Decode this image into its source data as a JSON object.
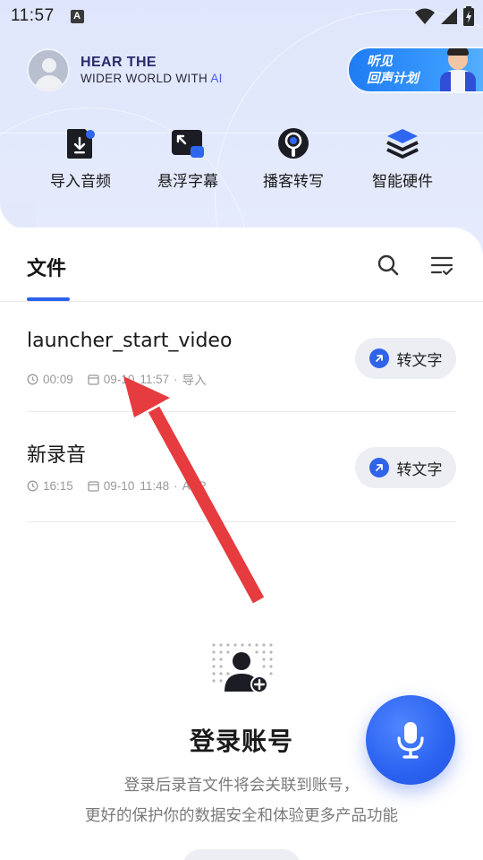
{
  "status_bar": {
    "time": "11:57",
    "notification_icon": "A"
  },
  "header": {
    "slogan_line1_prefix": "HEAR THE",
    "slogan_line2": "WIDER WORLD WITH",
    "slogan_line2_ai": "AI",
    "promo_line1": "听见",
    "promo_line2": "回声计划"
  },
  "quick_actions": [
    {
      "label": "导入音频",
      "icon": "import-audio-icon"
    },
    {
      "label": "悬浮字幕",
      "icon": "floating-subtitle-icon"
    },
    {
      "label": "播客转写",
      "icon": "podcast-transcribe-icon"
    },
    {
      "label": "智能硬件",
      "icon": "smart-hardware-icon"
    }
  ],
  "tabs": {
    "files_label": "文件"
  },
  "files": [
    {
      "title": "launcher_start_video",
      "duration": "00:09",
      "date": "09-10",
      "time": "11:57",
      "source": "导入",
      "action": "转文字"
    },
    {
      "title": "新录音",
      "duration": "16:15",
      "date": "09-10",
      "time": "11:48",
      "source": "APP",
      "action": "转文字"
    }
  ],
  "login": {
    "title": "登录账号",
    "desc_line1": "登录后录音文件将会关联到账号，",
    "desc_line2": "更好的保护你的数据安全和体验更多产品功能"
  },
  "colors": {
    "accent": "#2a63ee",
    "annotation_arrow": "#e63b3f"
  }
}
